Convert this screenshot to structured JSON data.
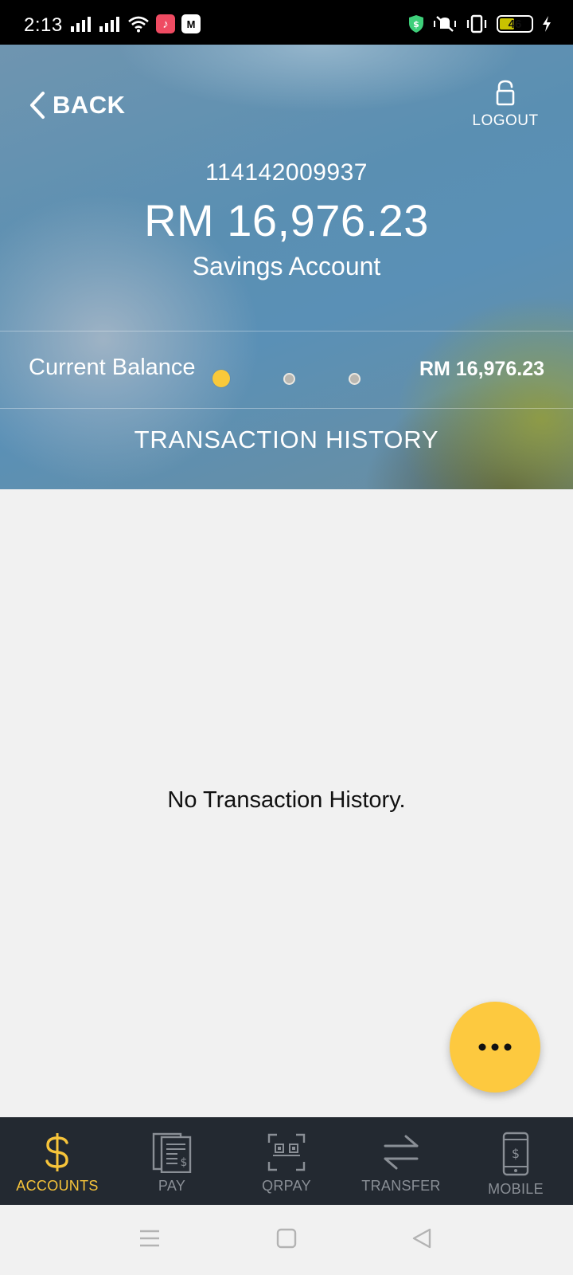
{
  "status_bar": {
    "time": "2:13",
    "battery_level": "46"
  },
  "header": {
    "back_label": "BACK",
    "logout_label": "LOGOUT",
    "account_number": "114142009937",
    "balance": "RM 16,976.23",
    "account_type": "Savings Account",
    "current_balance_label": "Current Balance",
    "current_balance_value": "RM 16,976.23",
    "carousel": {
      "active_index": 0,
      "count": 3
    },
    "tab_label": "TRANSACTION HISTORY"
  },
  "main": {
    "empty_message": "No Transaction History."
  },
  "bottom_nav": {
    "items": [
      {
        "label": "ACCOUNTS",
        "icon": "dollar-icon",
        "active": true
      },
      {
        "label": "PAY",
        "icon": "bill-icon",
        "active": false
      },
      {
        "label": "QRPAY",
        "icon": "qr-scan-icon",
        "active": false
      },
      {
        "label": "TRANSFER",
        "icon": "transfer-arrows-icon",
        "active": false
      },
      {
        "label": "MOBILE",
        "icon": "mobile-dollar-icon",
        "active": false
      }
    ]
  },
  "colors": {
    "accent": "#fdc93f",
    "nav_bg": "#232931",
    "nav_inactive": "#8a8f96",
    "body_bg": "#f1f1f1"
  }
}
